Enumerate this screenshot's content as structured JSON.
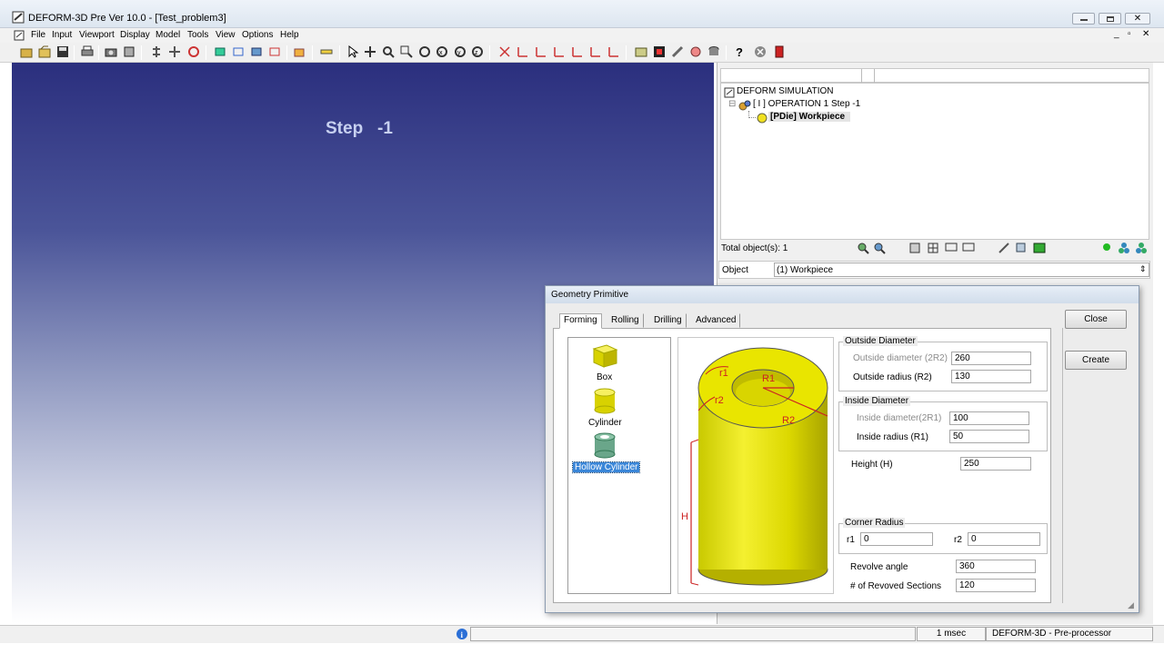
{
  "window": {
    "title": "DEFORM-3D Pre Ver 10.0 - [Test_problem3]"
  },
  "menu": [
    "File",
    "Input",
    "Viewport",
    "Display",
    "Model",
    "Tools",
    "View",
    "Options",
    "Help"
  ],
  "viewport": {
    "step_label": "Step   -1"
  },
  "tree": {
    "root": "DEFORM SIMULATION",
    "operation": "[ I ]  OPERATION 1  Step -1",
    "object": "[PDie] Workpiece"
  },
  "object_panel": {
    "total_label": "Total object(s): 1",
    "object_label": "Object",
    "object_value": "(1) Workpiece"
  },
  "dialog": {
    "title": "Geometry Primitive",
    "tabs": [
      "Forming",
      "Rolling",
      "Drilling",
      "Advanced"
    ],
    "active_tab": "Forming",
    "close_label": "Close",
    "create_label": "Create",
    "shapes": [
      "Box",
      "Cylinder",
      "Hollow Cylinder"
    ],
    "selected_shape": "Hollow Cylinder",
    "outside_diameter": {
      "group": "Outside Diameter",
      "diam_label": "Outside diameter (2R2)",
      "diam_value": "260",
      "radius_label": "Outside radius (R2)",
      "radius_value": "130"
    },
    "inside_diameter": {
      "group": "Inside Diameter",
      "diam_label": "Inside diameter(2R1)",
      "diam_value": "100",
      "radius_label": "Inside radius (R1)",
      "radius_value": "50"
    },
    "height": {
      "label": "Height (H)",
      "value": "250"
    },
    "corner_radius": {
      "group": "Corner Radius",
      "r1_label": "r1",
      "r1_value": "0",
      "r2_label": "r2",
      "r2_value": "0"
    },
    "revolve_angle": {
      "label": "Revolve angle",
      "value": "360"
    },
    "sections": {
      "label": "# of Revoved Sections",
      "value": "120"
    },
    "preview_labels": {
      "r1": "r1",
      "R1": "R1",
      "r2": "r2",
      "R2": "R2",
      "H": "H"
    }
  },
  "status": {
    "time": "1 msec",
    "mode": "DEFORM-3D  -  Pre-processor"
  },
  "colors": {
    "viewport_top": "#2b2f7e",
    "viewport_bottom": "#ffffff",
    "step_text": "#c7d0f0",
    "cylinder": "#e6e600",
    "selection": "#3a86d8"
  }
}
